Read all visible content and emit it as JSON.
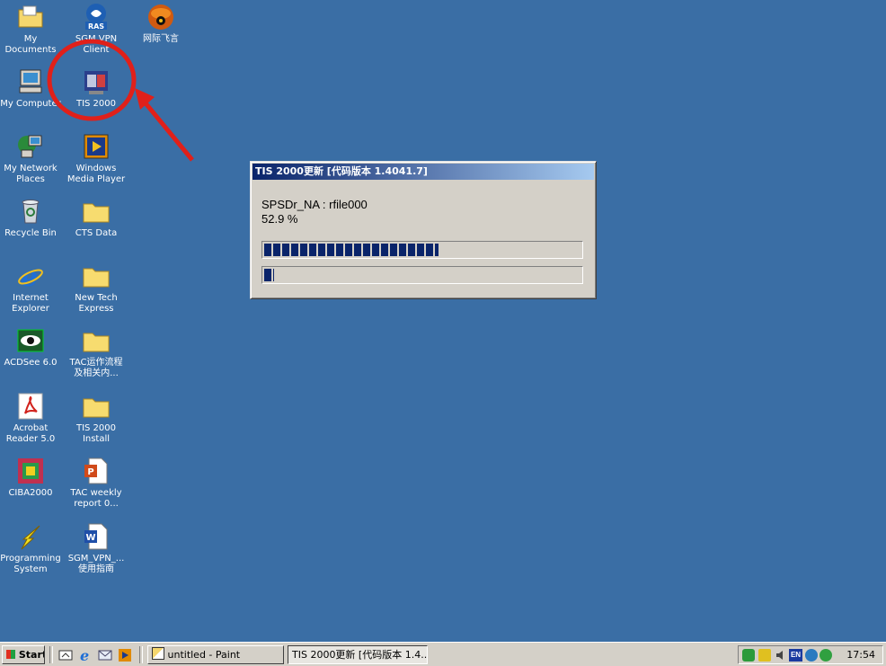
{
  "desktop": {
    "icons": [
      {
        "label": "My Documents",
        "icon": "folder-documents-icon"
      },
      {
        "label": "SGM VPN\nClient",
        "icon": "ras-vpn-icon"
      },
      {
        "label": "网际飞言",
        "icon": "chat-app-icon"
      },
      {
        "label": "My Computer",
        "icon": "computer-icon"
      },
      {
        "label": "TIS 2000",
        "icon": "tis2000-icon"
      },
      {
        "label": "My Network\nPlaces",
        "icon": "network-icon"
      },
      {
        "label": "Windows\nMedia Player",
        "icon": "media-player-icon"
      },
      {
        "label": "Recycle Bin",
        "icon": "recycle-bin-icon"
      },
      {
        "label": "CTS Data",
        "icon": "folder-icon"
      },
      {
        "label": "Internet\nExplorer",
        "icon": "internet-explorer-icon"
      },
      {
        "label": "New Tech\nExpress",
        "icon": "folder-icon"
      },
      {
        "label": "ACDSee 6.0",
        "icon": "acdsee-icon"
      },
      {
        "label": "TAC运作流程\n及相关内...",
        "icon": "folder-icon"
      },
      {
        "label": "Acrobat\nReader 5.0",
        "icon": "acrobat-icon"
      },
      {
        "label": "TIS 2000\nInstall",
        "icon": "folder-icon"
      },
      {
        "label": "CIBA2000",
        "icon": "ciba-icon"
      },
      {
        "label": "TAC weekly\nreport 0...",
        "icon": "powerpoint-icon"
      },
      {
        "label": "Programming\nSystem",
        "icon": "lightning-icon"
      },
      {
        "label": "SGM_VPN_...\n使用指南",
        "icon": "word-doc-icon"
      }
    ]
  },
  "dialog": {
    "title": "TIS 2000更新 [代码版本 1.4041.7]",
    "file_line": "SPSDr_NA :  rfile000",
    "percent_text": "52.9 %",
    "progress_overall": 0.55,
    "progress_file": 0.03
  },
  "taskbar": {
    "start_label": "Start",
    "tasks": [
      {
        "label": "untitled - Paint",
        "icon": "paint-icon"
      },
      {
        "label": "TIS 2000更新 [代码版本 1.4...",
        "icon": "none"
      }
    ],
    "tray_lang": "EN",
    "clock": "17:54"
  },
  "colors": {
    "desktop": "#3a6ea5",
    "highlight_circle": "#e0201a",
    "progress": "#0a246a"
  }
}
